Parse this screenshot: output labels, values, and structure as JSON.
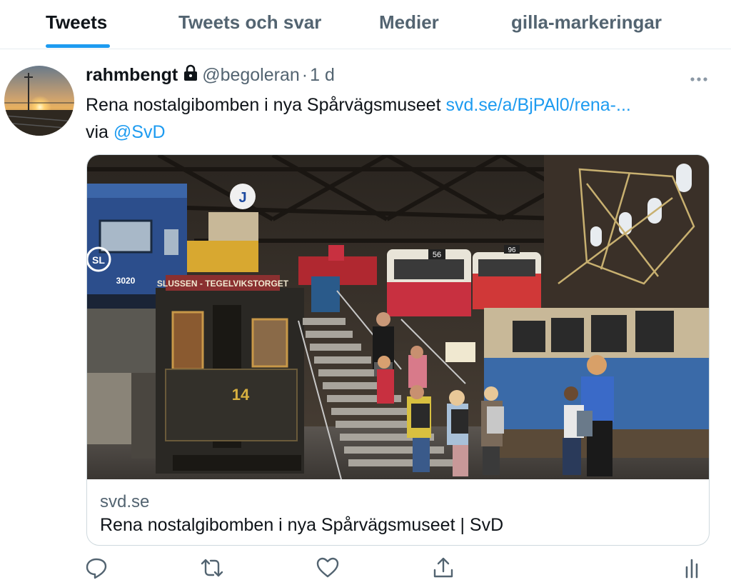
{
  "tabs": [
    {
      "label": "Tweets",
      "active": true
    },
    {
      "label": "Tweets och svar",
      "active": false
    },
    {
      "label": "Medier",
      "active": false
    },
    {
      "label": "gilla-markeringar",
      "active": false
    }
  ],
  "tweet": {
    "author_name": "rahmbengt",
    "protected_icon": "lock-icon",
    "handle": "@begoleran",
    "separator": "·",
    "time": "1 d",
    "text": "Rena nostalgibomben i nya Spårvägsmuseet ",
    "link": "svd.se/a/BjPAl0/rena-...",
    "via_label": "via ",
    "mention": "@SvD"
  },
  "card": {
    "domain": "svd.se",
    "title": "Rena nostalgibomben i nya Spårvägsmuseet | SvD",
    "image_signs": {
      "tram_destination": "SLUSSEN - TEGELVIKSTORGET",
      "tram_number": "14",
      "train_number": "3020",
      "train_logo": "SL",
      "tram_route_a": "56",
      "tram_route_b": "96"
    }
  },
  "actions": {
    "reply_icon": "reply-icon",
    "retweet_icon": "retweet-icon",
    "like_icon": "heart-icon",
    "share_icon": "share-icon",
    "analytics_icon": "analytics-icon"
  },
  "colors": {
    "accent": "#1d9bf0",
    "text": "#0f1419",
    "secondary": "#536471",
    "border": "#cfd9de"
  }
}
